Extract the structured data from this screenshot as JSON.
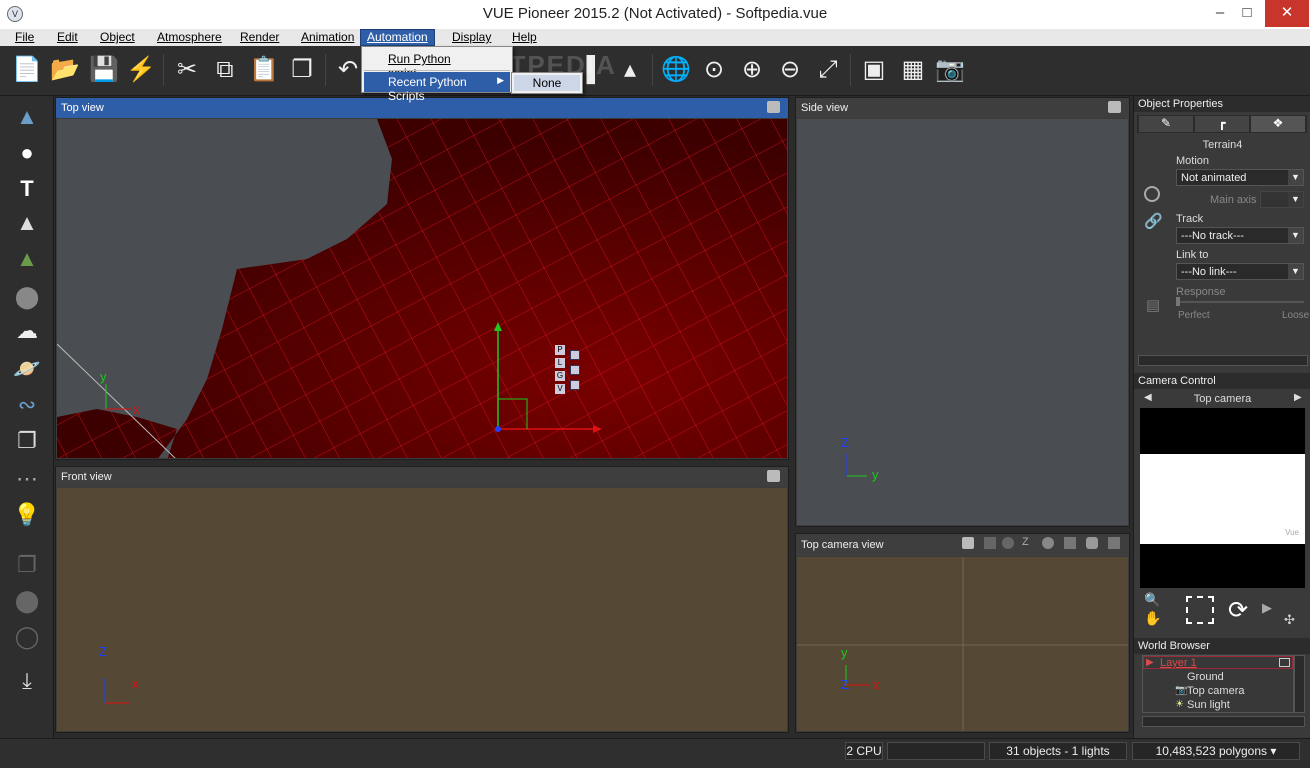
{
  "window": {
    "title": "VUE Pioneer 2015.2 (Not Activated) - Softpedia.vue"
  },
  "menus": [
    "File",
    "Edit",
    "Object",
    "Atmosphere",
    "Render",
    "Animation",
    "Automation",
    "Display",
    "Help"
  ],
  "active_menu": "Automation",
  "automation_menu": {
    "items": [
      "Run Python script...",
      "Recent Python Scripts"
    ],
    "submenu": [
      "None"
    ]
  },
  "watermark": "SOFTPEDIA",
  "viewports": {
    "top": {
      "label": "Top view"
    },
    "side": {
      "label": "Side view"
    },
    "front": {
      "label": "Front view"
    },
    "camera": {
      "label": "Top camera view"
    }
  },
  "gizmo_buttons": [
    "P",
    "L",
    "G",
    "V"
  ],
  "object_properties": {
    "header": "Object Properties",
    "object_name": "Terrain4",
    "motion_label": "Motion",
    "motion_value": "Not animated",
    "main_axis_label": "Main axis",
    "track_label": "Track",
    "track_value": "---No track---",
    "link_label": "Link to",
    "link_value": "---No link---",
    "response_label": "Response",
    "perfect_label": "Perfect",
    "loose_label": "Loose"
  },
  "camera_control": {
    "header": "Camera Control",
    "camera_name": "Top camera",
    "preview_logo": "Vue"
  },
  "world_browser": {
    "header": "World Browser",
    "layer": "Layer 1",
    "items": [
      "Ground",
      "Top camera",
      "Sun light"
    ]
  },
  "status": {
    "cpu": "2 CPU",
    "objects": "31 objects - 1 lights",
    "polygons": "10,483,523 polygons"
  },
  "colors": {
    "accent": "#2f5ea8",
    "terrain": "#5a0000",
    "ground": "#554834"
  }
}
